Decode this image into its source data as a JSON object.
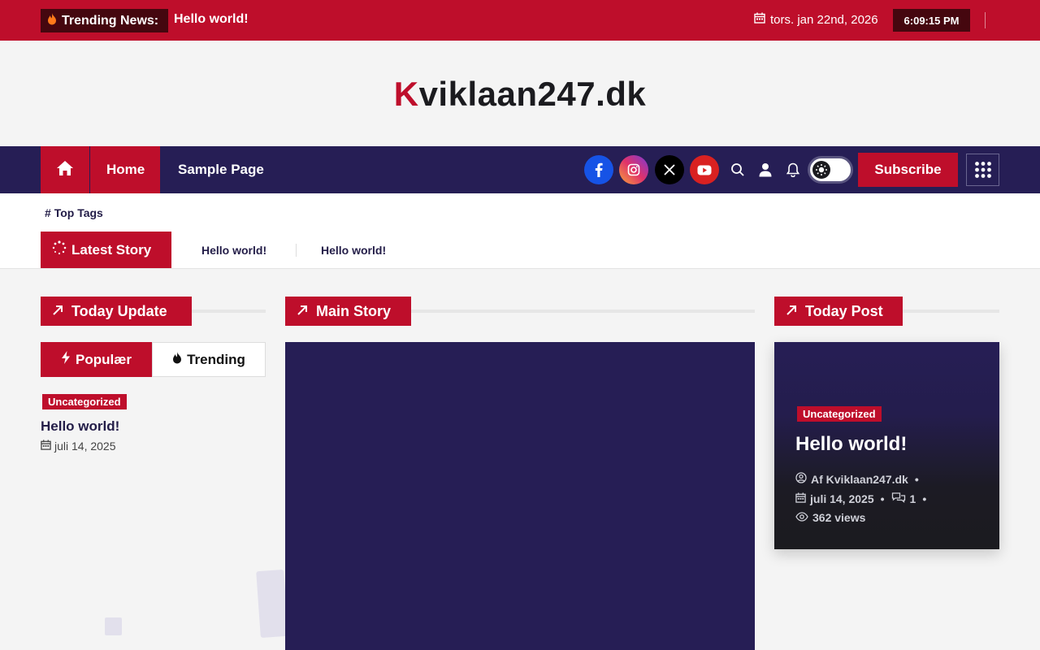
{
  "topbar": {
    "trending_label": "Trending News:",
    "trending_text": "Hello world!",
    "date": "tors. jan 22nd, 2026",
    "time": "6:09:15 PM"
  },
  "header": {
    "logo_first": "K",
    "logo_rest": "viklaan247.dk"
  },
  "nav": {
    "items": [
      {
        "label": "Home"
      },
      {
        "label": "Sample Page"
      }
    ],
    "subscribe_label": "Subscribe",
    "social": [
      "facebook-icon",
      "instagram-icon",
      "x-icon",
      "youtube-icon"
    ]
  },
  "tags": {
    "top_tags_label": "Top Tags",
    "latest_label": "Latest Story",
    "latest_items": [
      "Hello world!",
      "Hello world!"
    ]
  },
  "left": {
    "section_title": "Today Update",
    "tabs": [
      "Populær",
      "Trending"
    ],
    "post": {
      "category": "Uncategorized",
      "title": "Hello world!",
      "date": "juli 14, 2025"
    }
  },
  "center": {
    "section_title": "Main Story"
  },
  "right": {
    "section_title": "Today Post",
    "post": {
      "category": "Uncategorized",
      "title": "Hello world!",
      "author": "Af Kviklaan247.dk",
      "date": "juli 14, 2025",
      "comments": "1",
      "views": "362 views"
    }
  },
  "colors": {
    "accent": "#be0e2b",
    "dark_navy": "#261e55",
    "dark_red": "#45070f"
  }
}
